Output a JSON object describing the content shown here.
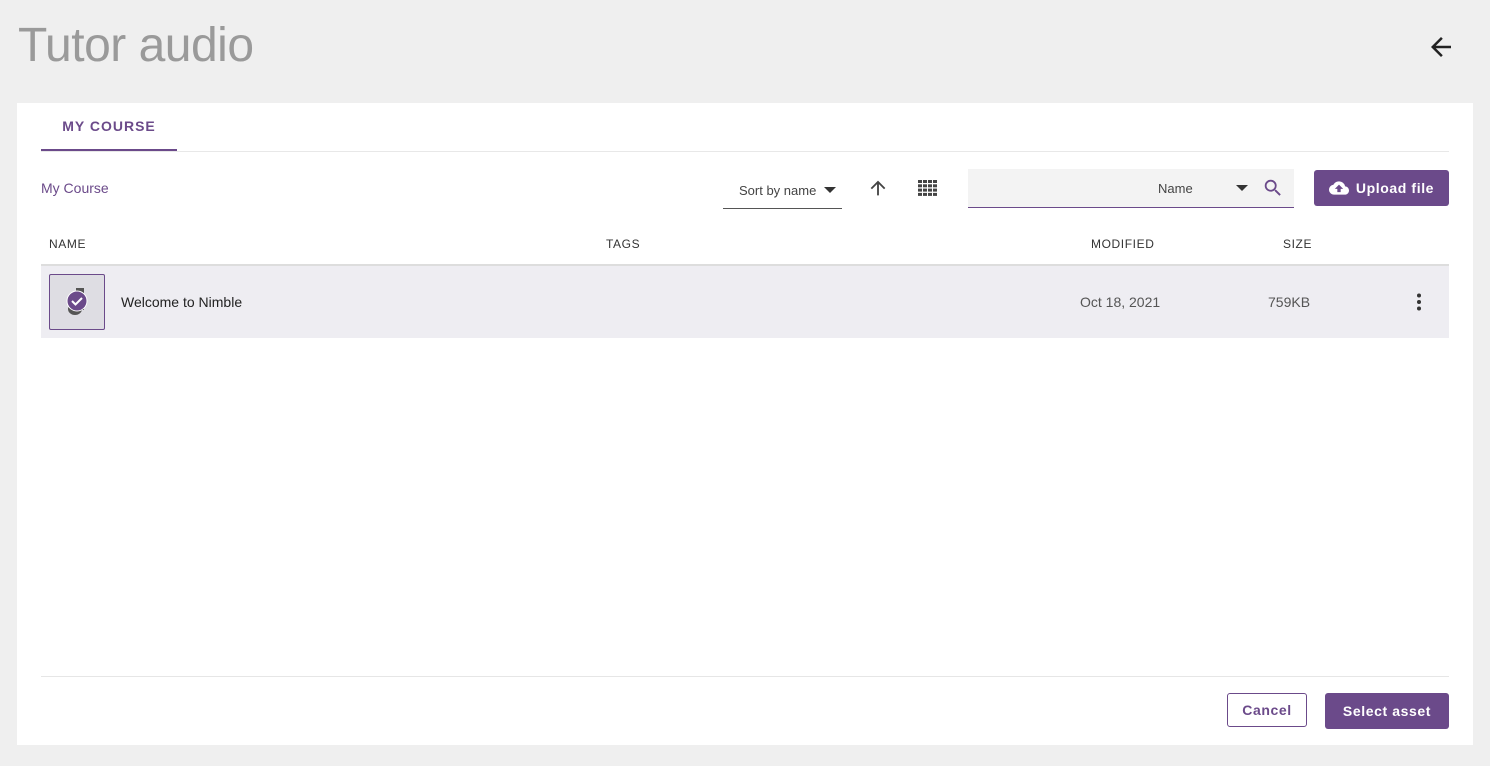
{
  "header": {
    "title": "Tutor audio",
    "back_icon": "arrow-left-icon"
  },
  "tabs": [
    {
      "label": "MY COURSE",
      "active": true
    }
  ],
  "breadcrumb": {
    "label": "My Course"
  },
  "toolbar": {
    "sort_label": "Sort by name",
    "sort_direction_icon": "arrow-up-icon",
    "view_icon": "grid-view-icon",
    "search": {
      "value": "",
      "placeholder": "",
      "field_label": "Name",
      "icon": "search-icon"
    },
    "upload_label": "Upload file",
    "upload_icon": "cloud-upload-icon"
  },
  "table": {
    "columns": {
      "name": "NAME",
      "tags": "TAGS",
      "modified": "MODIFIED",
      "size": "SIZE"
    },
    "rows": [
      {
        "name": "Welcome to Nimble",
        "tags": "",
        "modified": "Oct 18, 2021",
        "size": "759KB",
        "thumbnail_icon": "audio-file-check-icon",
        "menu_icon": "more-vertical-icon",
        "selected": true
      }
    ]
  },
  "footer": {
    "cancel_label": "Cancel",
    "select_label": "Select asset"
  },
  "colors": {
    "accent": "#6b4a8a",
    "page_background": "#efefef",
    "selected_row": "#eeedf2",
    "title_gray": "#9a9a9a"
  }
}
